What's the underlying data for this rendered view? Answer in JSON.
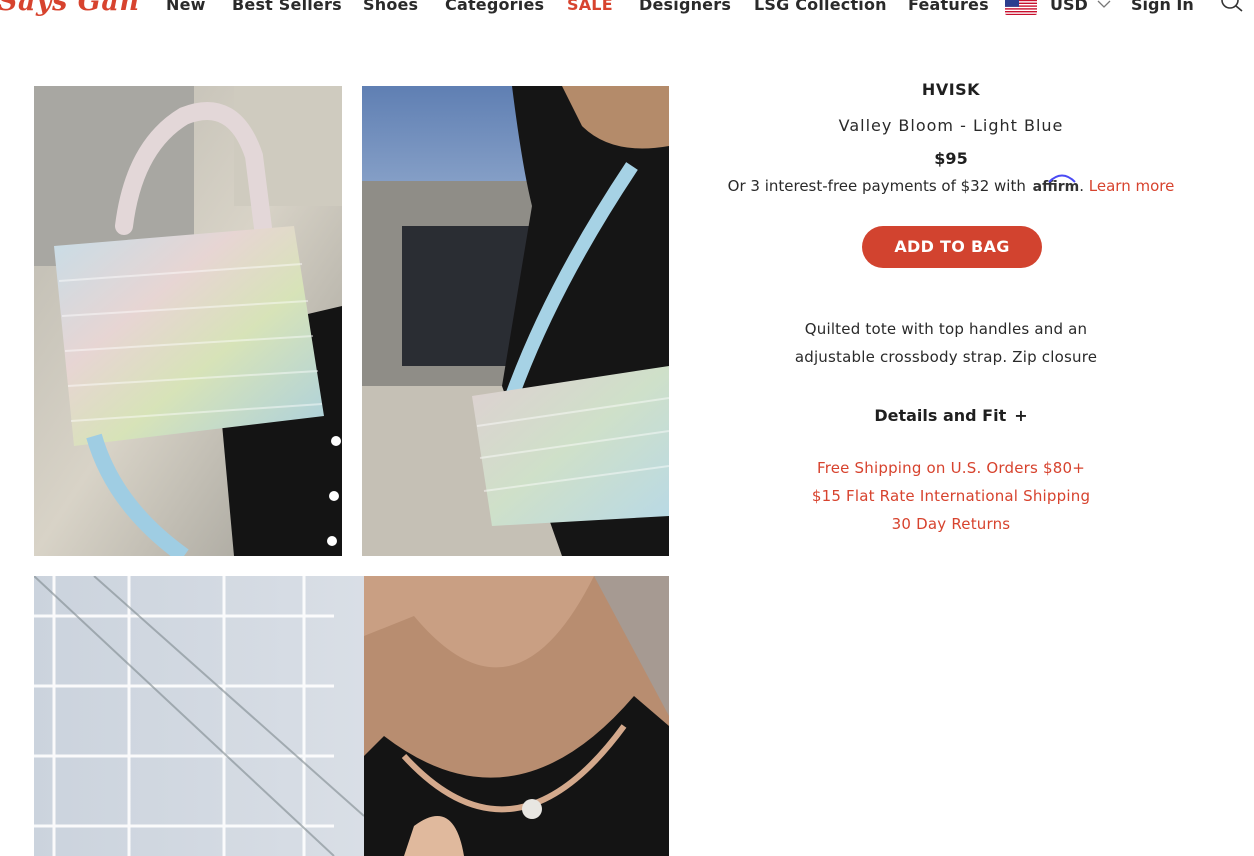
{
  "header": {
    "logo_text": "Says Gan",
    "nav": [
      {
        "label": "New"
      },
      {
        "label": "Best Sellers"
      },
      {
        "label": "Shoes"
      },
      {
        "label": "Categories"
      },
      {
        "label": "SALE"
      },
      {
        "label": "Designers"
      },
      {
        "label": "LSG Collection"
      },
      {
        "label": "Features"
      }
    ],
    "currency": "USD",
    "flag_icon": "us-flag-icon",
    "signin": "Sign In",
    "search_icon": "search-icon",
    "accent_color": "#d7432e"
  },
  "product": {
    "brand": "HVISK",
    "name": "Valley Bloom - Light Blue",
    "price": "$95",
    "affirm": {
      "prefix": "Or 3 interest-free payments of $32 with",
      "logo": "affirm",
      "dot": ".",
      "link": "Learn more"
    },
    "add_button": "ADD TO BAG",
    "description": "Quilted tote with top handles and an adjustable crossbody strap. Zip closure",
    "details_label": "Details and Fit",
    "details_icon": "+",
    "shipping": [
      "Free Shipping on U.S. Orders $80+",
      "$15 Flat Rate International Shipping",
      "30 Day Returns"
    ],
    "button_color": "#d2432f"
  },
  "images": [
    {
      "name": "product-photo-1"
    },
    {
      "name": "product-photo-2"
    },
    {
      "name": "product-photo-3"
    }
  ]
}
